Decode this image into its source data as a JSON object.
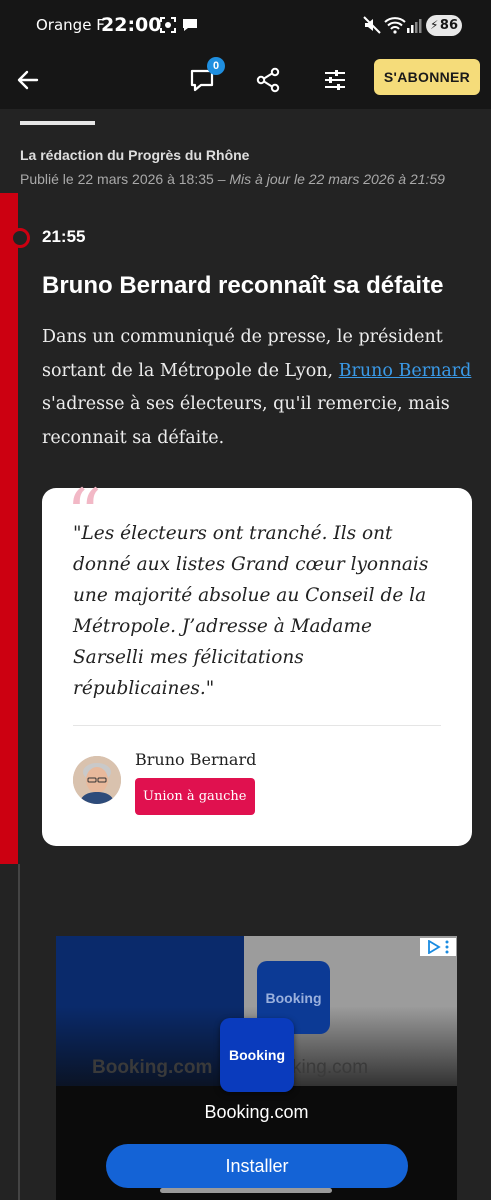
{
  "status_bar": {
    "carrier": "Orange F",
    "time": "22:00",
    "battery": "86"
  },
  "toolbar": {
    "comment_count": "0",
    "subscribe_label": "S'ABONNER"
  },
  "article": {
    "author": "La rédaction du Progrès du Rhône",
    "published": "Publié le 22 mars 2026 à 18:35",
    "updated_separator": " – ",
    "updated": "Mis à jour le 22 mars 2026 à 21:59"
  },
  "entry": {
    "time": "21:55",
    "title": "Bruno Bernard reconnaît sa défaite",
    "body_before_link": "Dans un communiqué de presse, le président sortant de la Métropole de Lyon, ",
    "body_link": "Bruno Bernard",
    "body_after_link": " s'adresse à ses électeurs, qu'il remercie, mais reconnait sa défaite."
  },
  "quote": {
    "mark": "“",
    "text": "\"Les électeurs ont tranché. Ils ont donné aux listes Grand cœur lyonnais une majorité absolue au Conseil de la Métropole. J’adresse à Madame Sarselli mes félicitations républicaines.\"",
    "author": "Bruno Bernard",
    "party": "Union à gauche"
  },
  "ad": {
    "bg_brand_left": "Booking.com",
    "bg_brand_right": "king.com",
    "tile_back_label": "Booking",
    "tile_label": "Booking",
    "app_name": "Booking.com",
    "install_label": "Installer"
  },
  "colors": {
    "accent_red": "#cc0011",
    "link_blue": "#3a9ae8",
    "subscribe_yellow": "#f5dc7a",
    "party_pink": "#e0114f"
  }
}
